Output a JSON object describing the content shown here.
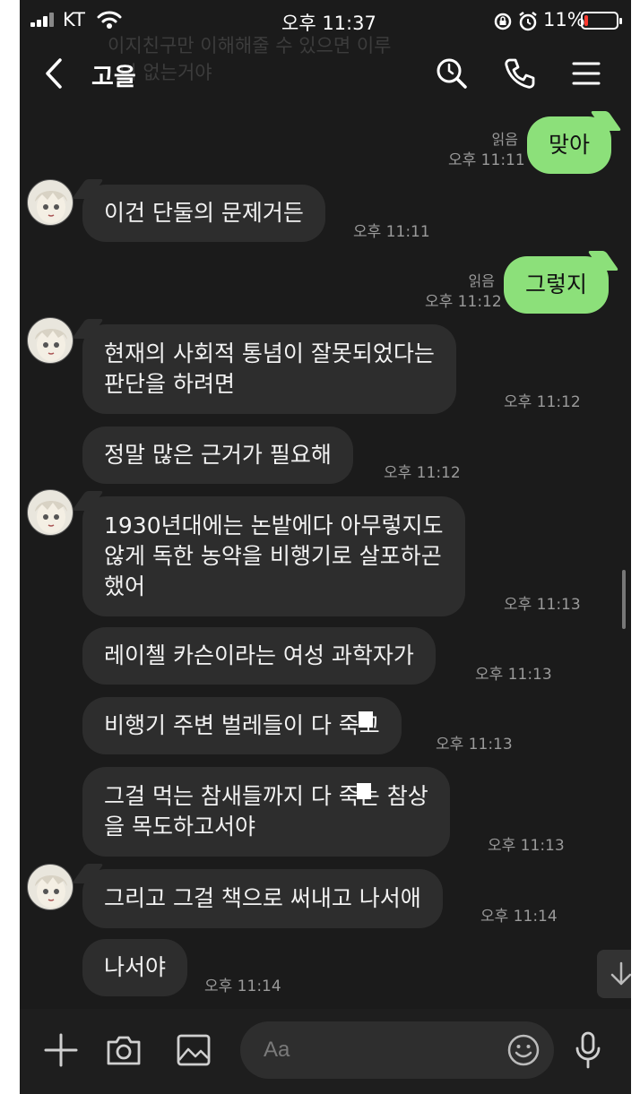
{
  "status_bar": {
    "carrier": "KT",
    "time": "오후 11:37",
    "battery_percent": "11%",
    "battery_level": 0.11
  },
  "header": {
    "title": "고을",
    "overlay_text": "이지친구만 이해해줄 수 있으면 이루\n  이 없는거야"
  },
  "messages": [
    {
      "side": "me",
      "text": "맞아",
      "read": "읽음",
      "time": "오후 11:11"
    },
    {
      "side": "them",
      "text": "이건 단둘의 문제거든",
      "time": "오후 11:11"
    },
    {
      "side": "me",
      "text": "그렇지",
      "read": "읽음",
      "time": "오후 11:12"
    },
    {
      "side": "them",
      "text": "현재의 사회적 통념이 잘못되었다는\n판단을 하려면",
      "time": "오후 11:12"
    },
    {
      "side": "them",
      "text": "정말 많은 근거가 필요해",
      "time": "오후 11:12"
    },
    {
      "side": "them",
      "text": "1930년대에는 논밭에다 아무렇지도\n않게 독한 농약을 비행기로 살포하곤\n했어",
      "time": "오후 11:13"
    },
    {
      "side": "them",
      "text": "레이첼 카슨이라는 여성 과학자가",
      "time": "오후 11:13"
    },
    {
      "side": "them",
      "text": "비행기 주변 벌레들이 다 죽고",
      "time": "오후 11:13"
    },
    {
      "side": "them",
      "text": "그걸 먹는 참새들까지 다 죽는 참상\n을 목도하고서야",
      "time": "오후 11:13"
    },
    {
      "side": "them",
      "text": "그리고 그걸 책으로 써내고 나서애",
      "time": "오후 11:14"
    },
    {
      "side": "them",
      "text": "나서야",
      "time": "오후 11:14"
    }
  ],
  "input": {
    "placeholder": "Aa"
  },
  "icons": {
    "back": "chevron-left-icon",
    "search": "search-icon",
    "call": "phone-icon",
    "menu": "hamburger-menu-icon",
    "plus": "plus-icon",
    "camera": "camera-icon",
    "gallery": "image-icon",
    "emoji": "emoji-icon",
    "mic": "microphone-icon",
    "scroll_down": "arrow-down-icon"
  },
  "colors": {
    "background": "#1b1b1b",
    "incoming_bubble": "#2d2d2d",
    "outgoing_bubble": "#8ce07a",
    "timestamp": "#9a9a9a",
    "battery_low": "#ff3b30"
  }
}
